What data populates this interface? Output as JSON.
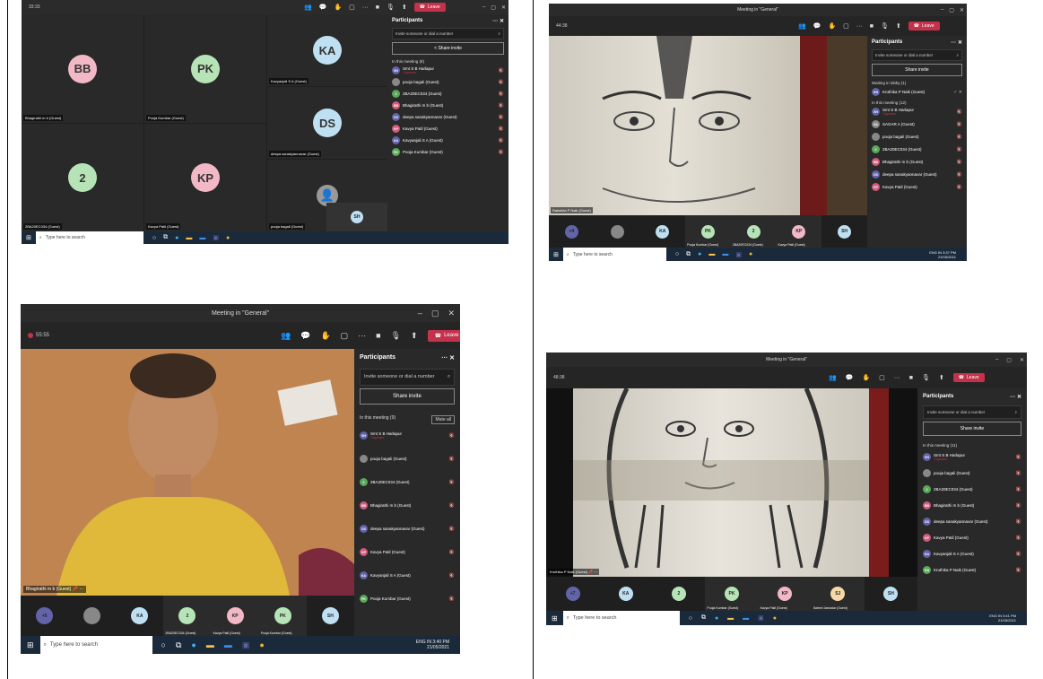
{
  "colors": {
    "leave": "#c4314b",
    "teams_purple": "#6264a7",
    "bg": "#1f1f1f"
  },
  "shot1": {
    "timer": "33:33",
    "leave": "Leave",
    "panel_title": "Participants",
    "invite_placeholder": "Invite someone or dial a number",
    "share": "Share invite",
    "section": "In this meeting (8)",
    "participants": [
      {
        "initials": "SH",
        "name": "Smt S B Harlapur",
        "sub": "Organizer",
        "color": "#6264a7"
      },
      {
        "initials": "",
        "name": "pooja bagali (Guest)",
        "color": "#888"
      },
      {
        "initials": "2",
        "name": "2BA20EC034 (Guest)",
        "color": "#5ba85b"
      },
      {
        "initials": "BB",
        "name": "Bhagirathi m b (Guest)",
        "color": "#d05c7a"
      },
      {
        "initials": "DS",
        "name": "deepa sanakyannavar (Guest)",
        "color": "#6264a7"
      },
      {
        "initials": "KP",
        "name": "Kavya Patil (Guest)",
        "color": "#d05c7a"
      },
      {
        "initials": "KA",
        "name": "Kavyanjali S A (Guest)",
        "color": "#6264a7"
      },
      {
        "initials": "PK",
        "name": "Pooja Kumbar (Guest)",
        "color": "#5ba85b"
      }
    ],
    "tiles": [
      {
        "initials": "BB",
        "name": "Bhagirathi m b (Guest)",
        "color": "#f2b8c6"
      },
      {
        "initials": "PK",
        "name": "Pooja Kumbar (Guest)",
        "color": "#b7e4b7"
      },
      {
        "initials": "KA",
        "name": "Kavyanjali S A (Guest)",
        "color": "#bfe0f2"
      },
      {
        "initials": "DS",
        "name": "deepa sanakyannavar (Guest)",
        "color": "#bfe0f2"
      },
      {
        "initials": "2",
        "name": "2BA20EC034 (Guest)",
        "color": "#b7e4b7"
      },
      {
        "initials": "KP",
        "name": "Kavya Patil (Guest)",
        "color": "#f2b8c6"
      },
      {
        "initials": "",
        "name": "pooja bagali (Guest)",
        "color": "#999"
      }
    ],
    "self_initials": "SH",
    "search": "Type here to search"
  },
  "shot2": {
    "title": "Meeting in \"General\"",
    "timer": "44:38",
    "leave": "Leave",
    "panel_title": "Participants",
    "invite_placeholder": "Invite someone or dial a number",
    "share": "Share invite",
    "lobby": "Waiting in lobby (1)",
    "lobby_person": "Kruthika P Naik (Guest)",
    "section": "In this meeting (12)",
    "participants": [
      {
        "initials": "SH",
        "name": "Smt S B Harlapur",
        "sub": "Organizer",
        "color": "#6264a7"
      },
      {
        "initials": "SA",
        "name": "SAGAR A (Guest)",
        "color": "#888"
      },
      {
        "initials": "",
        "name": "pooja bagali (Guest)",
        "color": "#888"
      },
      {
        "initials": "2",
        "name": "2BA20EC034 (Guest)",
        "color": "#5ba85b"
      },
      {
        "initials": "BB",
        "name": "Bhagirathi m b (Guest)",
        "color": "#d05c7a"
      },
      {
        "initials": "DS",
        "name": "deepa sanakyannavar (Guest)",
        "color": "#6264a7"
      },
      {
        "initials": "KP",
        "name": "Kavya Patil (Guest)",
        "color": "#d05c7a"
      }
    ],
    "speaker": "Rakshita P Naik (Guest)",
    "film": [
      {
        "initials": "+4",
        "color": "#6264a7",
        "name": ""
      },
      {
        "initials": "",
        "color": "#888",
        "name": ""
      },
      {
        "initials": "KA",
        "color": "#bfe0f2",
        "name": ""
      },
      {
        "initials": "PK",
        "color": "#b7e4b7",
        "name": "Pooja Kumbar (Guest)"
      },
      {
        "initials": "2",
        "color": "#b7e4b7",
        "name": "2BA20EC034 (Guest)"
      },
      {
        "initials": "KP",
        "color": "#f2b8c6",
        "name": "Kavya Patil (Guest)"
      },
      {
        "initials": "SH",
        "color": "#bfe0f2",
        "name": ""
      }
    ],
    "search": "Type here to search",
    "time": "3:37 PM",
    "date": "21/05/2021",
    "lang": "ENG IN"
  },
  "shot3": {
    "title": "Meeting in \"General\"",
    "timer": "55:55",
    "leave": "Leave",
    "panel_title": "Participants",
    "invite_placeholder": "Invite someone or dial a number",
    "share": "Share invite",
    "section": "In this meeting (9)",
    "mute_all": "Mute all",
    "participants": [
      {
        "initials": "SH",
        "name": "Smt S B Harlapur",
        "sub": "Organizer",
        "color": "#6264a7"
      },
      {
        "initials": "",
        "name": "pooja bagali (Guest)",
        "color": "#888"
      },
      {
        "initials": "2",
        "name": "2BA20EC034 (Guest)",
        "color": "#5ba85b"
      },
      {
        "initials": "BB",
        "name": "Bhagirathi m b (Guest)",
        "color": "#d05c7a"
      },
      {
        "initials": "DS",
        "name": "deepa sanakyannavar (Guest)",
        "color": "#6264a7"
      },
      {
        "initials": "KP",
        "name": "Kavya Patil (Guest)",
        "color": "#d05c7a"
      },
      {
        "initials": "KA",
        "name": "Kavyanjali S A (Guest)",
        "color": "#6264a7"
      },
      {
        "initials": "PK",
        "name": "Pooja Kumbar (Guest)",
        "color": "#5ba85b"
      }
    ],
    "speaker": "Bhagirathi m b (Guest)",
    "film": [
      {
        "initials": "+5",
        "color": "#6264a7",
        "name": ""
      },
      {
        "initials": "",
        "color": "#888",
        "name": ""
      },
      {
        "initials": "KA",
        "color": "#bfe0f2",
        "name": ""
      },
      {
        "initials": "2",
        "color": "#b7e4b7",
        "name": "2BA20EC034 (Guest)"
      },
      {
        "initials": "KP",
        "color": "#f2b8c6",
        "name": "Kavya Patil (Guest)"
      },
      {
        "initials": "PK",
        "color": "#b7e4b7",
        "name": "Pooja Kumbar (Guest)"
      },
      {
        "initials": "SH",
        "color": "#bfe0f2",
        "name": ""
      }
    ],
    "search": "Type here to search",
    "time": "3:40 PM",
    "date": "21/05/2021",
    "lang": "ENG IN"
  },
  "shot4": {
    "title": "Meeting in \"General\"",
    "timer": "48:38",
    "leave": "Leave",
    "panel_title": "Participants",
    "invite_placeholder": "Invite someone or dial a number",
    "share": "Share invite",
    "section": "In this meeting (11)",
    "participants": [
      {
        "initials": "SH",
        "name": "Smt S B Harlapur",
        "sub": "Organizer",
        "color": "#6264a7"
      },
      {
        "initials": "",
        "name": "pooja bagali (Guest)",
        "color": "#888"
      },
      {
        "initials": "2",
        "name": "2BA20EC034 (Guest)",
        "color": "#5ba85b"
      },
      {
        "initials": "BB",
        "name": "Bhagirathi m b (Guest)",
        "color": "#d05c7a"
      },
      {
        "initials": "DS",
        "name": "deepa sanakyannavar (Guest)",
        "color": "#6264a7"
      },
      {
        "initials": "KP",
        "name": "Kavya Patil (Guest)",
        "color": "#d05c7a"
      },
      {
        "initials": "KA",
        "name": "Kavyanjali S A (Guest)",
        "color": "#6264a7"
      },
      {
        "initials": "KN",
        "name": "Kruthika P Naik (Guest)",
        "color": "#5ba85b"
      }
    ],
    "speaker": "Kruthika P Naik (Guest)",
    "film": [
      {
        "initials": "+7",
        "color": "#6264a7",
        "name": ""
      },
      {
        "initials": "KA",
        "color": "#bfe0f2",
        "name": ""
      },
      {
        "initials": "2",
        "color": "#b7e4b7",
        "name": ""
      },
      {
        "initials": "PK",
        "color": "#b7e4b7",
        "name": "Pooja Kumbar (Guest)"
      },
      {
        "initials": "KP",
        "color": "#f2b8c6",
        "name": "Kavya Patil (Guest)"
      },
      {
        "initials": "SJ",
        "color": "#f5d9a8",
        "name": "Saheel Jamadar (Guest)"
      },
      {
        "initials": "SH",
        "color": "#bfe0f2",
        "name": ""
      }
    ],
    "search": "Type here to search",
    "time": "3:41 PM",
    "date": "21/05/2021",
    "lang": "ENG IN"
  }
}
